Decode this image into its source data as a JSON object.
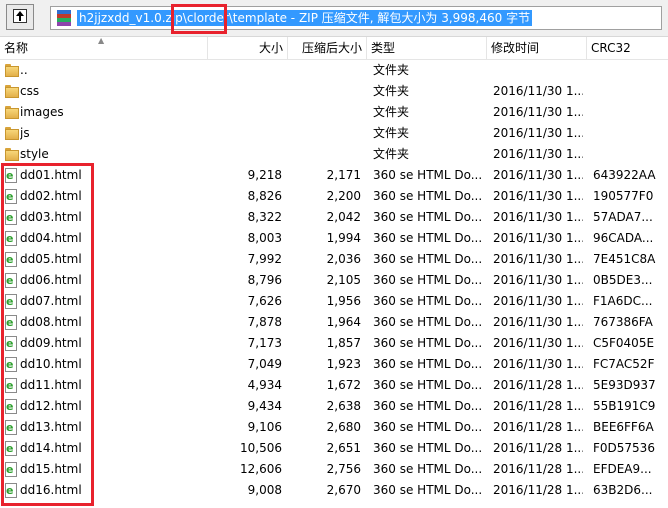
{
  "toolbar": {
    "path_text": "h2jjzxdd_v1.0.zip\\clorder\\template - ZIP 压缩文件, 解包大小为 3,998,460 字节"
  },
  "columns": {
    "name": "名称",
    "size": "大小",
    "compressed": "压缩后大小",
    "type": "类型",
    "modified": "修改时间",
    "crc": "CRC32"
  },
  "rows": [
    {
      "name": "..",
      "size": "",
      "compressed": "",
      "type": "文件夹",
      "modified": "",
      "crc": "",
      "icon": "folder-icon"
    },
    {
      "name": "css",
      "size": "",
      "compressed": "",
      "type": "文件夹",
      "modified": "2016/11/30 1...",
      "crc": "",
      "icon": "folder-icon"
    },
    {
      "name": "images",
      "size": "",
      "compressed": "",
      "type": "文件夹",
      "modified": "2016/11/30 1...",
      "crc": "",
      "icon": "folder-icon"
    },
    {
      "name": "js",
      "size": "",
      "compressed": "",
      "type": "文件夹",
      "modified": "2016/11/30 1...",
      "crc": "",
      "icon": "folder-icon"
    },
    {
      "name": "style",
      "size": "",
      "compressed": "",
      "type": "文件夹",
      "modified": "2016/11/30 1...",
      "crc": "",
      "icon": "folder-icon"
    },
    {
      "name": "dd01.html",
      "size": "9,218",
      "compressed": "2,171",
      "type": "360 se HTML Do...",
      "modified": "2016/11/30 1...",
      "crc": "643922AA",
      "icon": "html-file-icon"
    },
    {
      "name": "dd02.html",
      "size": "8,826",
      "compressed": "2,200",
      "type": "360 se HTML Do...",
      "modified": "2016/11/30 1...",
      "crc": "190577F0",
      "icon": "html-file-icon"
    },
    {
      "name": "dd03.html",
      "size": "8,322",
      "compressed": "2,042",
      "type": "360 se HTML Do...",
      "modified": "2016/11/30 1...",
      "crc": "57ADA7...",
      "icon": "html-file-icon"
    },
    {
      "name": "dd04.html",
      "size": "8,003",
      "compressed": "1,994",
      "type": "360 se HTML Do...",
      "modified": "2016/11/30 1...",
      "crc": "96CADA...",
      "icon": "html-file-icon"
    },
    {
      "name": "dd05.html",
      "size": "7,992",
      "compressed": "2,036",
      "type": "360 se HTML Do...",
      "modified": "2016/11/30 1...",
      "crc": "7E451C8A",
      "icon": "html-file-icon"
    },
    {
      "name": "dd06.html",
      "size": "8,796",
      "compressed": "2,105",
      "type": "360 se HTML Do...",
      "modified": "2016/11/30 1...",
      "crc": "0B5DE3...",
      "icon": "html-file-icon"
    },
    {
      "name": "dd07.html",
      "size": "7,626",
      "compressed": "1,956",
      "type": "360 se HTML Do...",
      "modified": "2016/11/30 1...",
      "crc": "F1A6DC...",
      "icon": "html-file-icon"
    },
    {
      "name": "dd08.html",
      "size": "7,878",
      "compressed": "1,964",
      "type": "360 se HTML Do...",
      "modified": "2016/11/30 1...",
      "crc": "767386FA",
      "icon": "html-file-icon"
    },
    {
      "name": "dd09.html",
      "size": "7,173",
      "compressed": "1,857",
      "type": "360 se HTML Do...",
      "modified": "2016/11/30 1...",
      "crc": "C5F0405E",
      "icon": "html-file-icon"
    },
    {
      "name": "dd10.html",
      "size": "7,049",
      "compressed": "1,923",
      "type": "360 se HTML Do...",
      "modified": "2016/11/30 1...",
      "crc": "FC7AC52F",
      "icon": "html-file-icon"
    },
    {
      "name": "dd11.html",
      "size": "4,934",
      "compressed": "1,672",
      "type": "360 se HTML Do...",
      "modified": "2016/11/28 1...",
      "crc": "5E93D937",
      "icon": "html-file-icon"
    },
    {
      "name": "dd12.html",
      "size": "9,434",
      "compressed": "2,638",
      "type": "360 se HTML Do...",
      "modified": "2016/11/28 1...",
      "crc": "55B191C9",
      "icon": "html-file-icon"
    },
    {
      "name": "dd13.html",
      "size": "9,106",
      "compressed": "2,680",
      "type": "360 se HTML Do...",
      "modified": "2016/11/28 1...",
      "crc": "BEE6FF6A",
      "icon": "html-file-icon"
    },
    {
      "name": "dd14.html",
      "size": "10,506",
      "compressed": "2,651",
      "type": "360 se HTML Do...",
      "modified": "2016/11/28 1...",
      "crc": "F0D57536",
      "icon": "html-file-icon"
    },
    {
      "name": "dd15.html",
      "size": "12,606",
      "compressed": "2,756",
      "type": "360 se HTML Do...",
      "modified": "2016/11/28 1...",
      "crc": "EFDEA9...",
      "icon": "html-file-icon"
    },
    {
      "name": "dd16.html",
      "size": "9,008",
      "compressed": "2,670",
      "type": "360 se HTML Do...",
      "modified": "2016/11/28 1...",
      "crc": "63B2D6...",
      "icon": "html-file-icon"
    }
  ],
  "colors": {
    "selection": "#3399ff",
    "highlight_box": "#e8222d",
    "folder": "#f7d77a"
  }
}
